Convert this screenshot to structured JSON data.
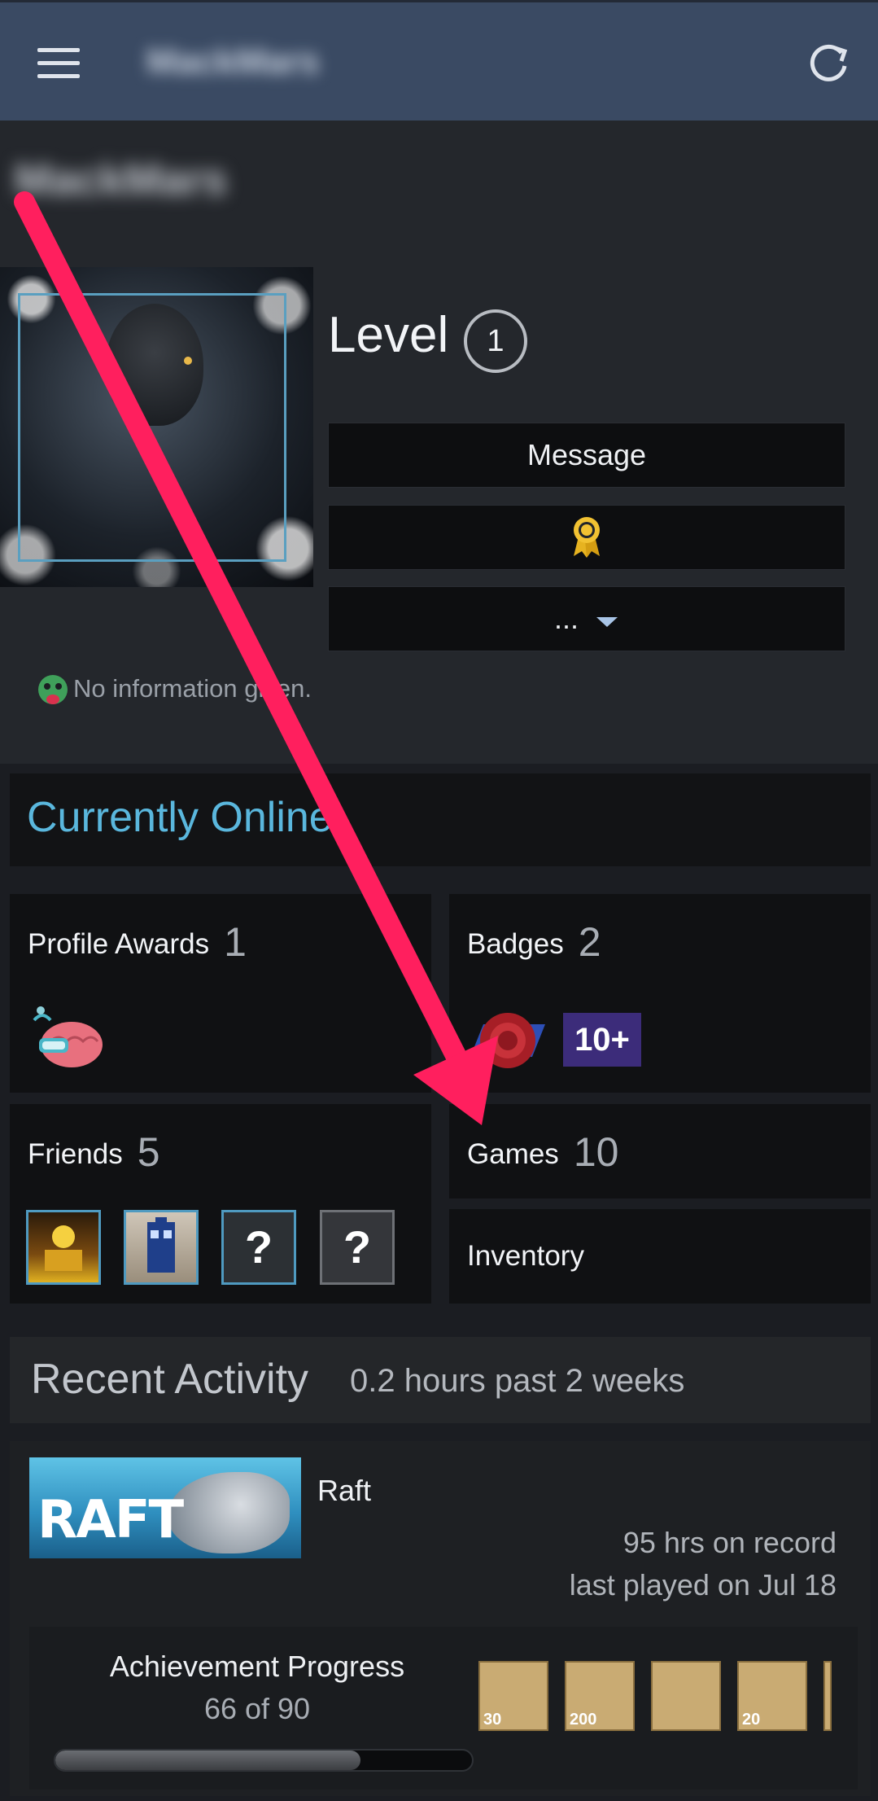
{
  "topbar": {
    "title": "MackMars"
  },
  "profile": {
    "persona_name": "MackMars",
    "persona_sub": "",
    "level_label": "Level",
    "level_value": "1",
    "buttons": {
      "message": "Message",
      "more": "..."
    },
    "status_text": "No information given."
  },
  "online_status": "Currently Online",
  "sections": {
    "profile_awards": {
      "label": "Profile Awards",
      "count": "1"
    },
    "badges": {
      "label": "Badges",
      "count": "2",
      "badge_text": "10+"
    },
    "friends": {
      "label": "Friends",
      "count": "5",
      "unknown_glyph": "?"
    },
    "games": {
      "label": "Games",
      "count": "10"
    },
    "inventory": {
      "label": "Inventory"
    }
  },
  "recent_activity": {
    "title": "Recent Activity",
    "summary": "0.2 hours past 2 weeks",
    "game": {
      "name": "Raft",
      "capsule_text": "RAFT",
      "hours": "95 hrs on record",
      "last_played": "last played on Jul 18",
      "achievement_title": "Achievement Progress",
      "achievement_count": "66 of 90",
      "achievement_progress": 0.733,
      "achievement_icon_labels": [
        "30",
        "200",
        "",
        "20"
      ]
    }
  },
  "colors": {
    "accent_online": "#5ab7dd",
    "annotation_arrow": "#ff1f5e",
    "header_bg": "#3a4a63"
  }
}
